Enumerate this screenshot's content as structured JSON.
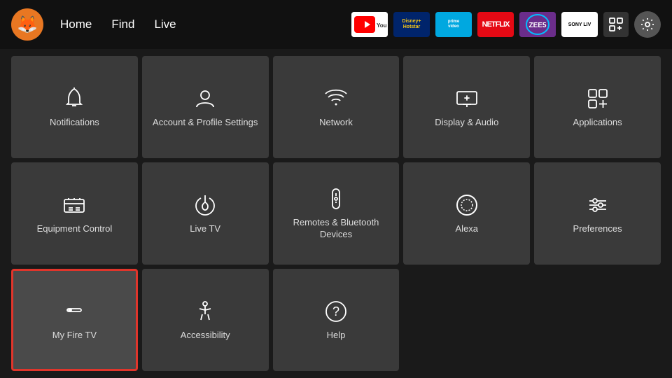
{
  "nav": {
    "logo": "🦊",
    "links": [
      "Home",
      "Find",
      "Live"
    ],
    "apps": [
      {
        "label": "▶ YouTube",
        "class": "app-youtube",
        "name": "youtube"
      },
      {
        "label": "Disney+ Hotstar",
        "class": "app-disney",
        "name": "disney"
      },
      {
        "label": "prime video",
        "class": "app-prime",
        "name": "prime"
      },
      {
        "label": "NETFLIX",
        "class": "app-netflix",
        "name": "netflix"
      },
      {
        "label": "ZEE5",
        "class": "app-zee5",
        "name": "zee5"
      },
      {
        "label": "SONY LIV",
        "class": "app-sony",
        "name": "sony"
      }
    ]
  },
  "grid": {
    "items": [
      {
        "id": "notifications",
        "label": "Notifications",
        "icon": "bell",
        "selected": false
      },
      {
        "id": "account",
        "label": "Account & Profile Settings",
        "icon": "person",
        "selected": false
      },
      {
        "id": "network",
        "label": "Network",
        "icon": "wifi",
        "selected": false
      },
      {
        "id": "display-audio",
        "label": "Display & Audio",
        "icon": "display",
        "selected": false
      },
      {
        "id": "applications",
        "label": "Applications",
        "icon": "apps",
        "selected": false
      },
      {
        "id": "equipment",
        "label": "Equipment Control",
        "icon": "tv",
        "selected": false
      },
      {
        "id": "live-tv",
        "label": "Live TV",
        "icon": "antenna",
        "selected": false
      },
      {
        "id": "remotes",
        "label": "Remotes & Bluetooth Devices",
        "icon": "remote",
        "selected": false
      },
      {
        "id": "alexa",
        "label": "Alexa",
        "icon": "alexa",
        "selected": false
      },
      {
        "id": "preferences",
        "label": "Preferences",
        "icon": "sliders",
        "selected": false
      },
      {
        "id": "my-fire-tv",
        "label": "My Fire TV",
        "icon": "firetv",
        "selected": true
      },
      {
        "id": "accessibility",
        "label": "Accessibility",
        "icon": "accessibility",
        "selected": false
      },
      {
        "id": "help",
        "label": "Help",
        "icon": "help",
        "selected": false
      }
    ]
  }
}
